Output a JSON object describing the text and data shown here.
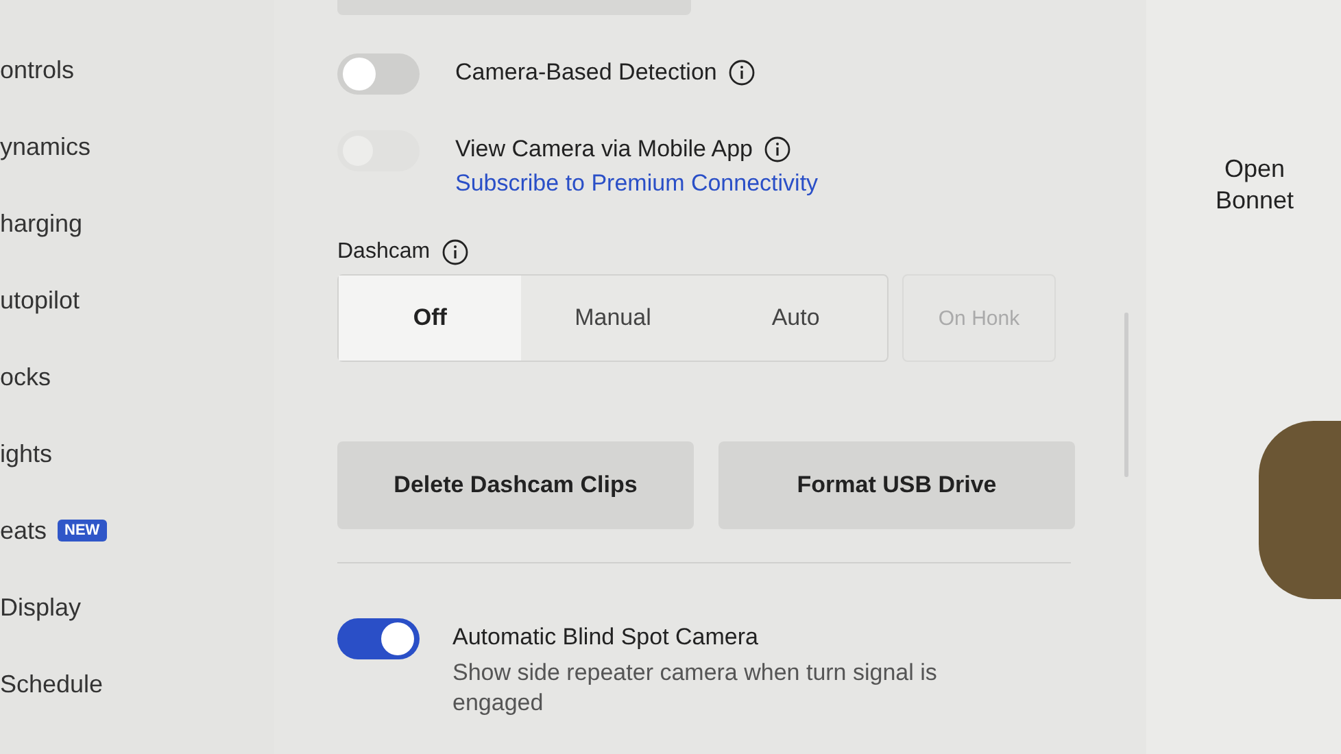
{
  "sidebar": {
    "items": [
      {
        "label": "ontrols"
      },
      {
        "label": "ynamics"
      },
      {
        "label": "harging"
      },
      {
        "label": "utopilot"
      },
      {
        "label": "ocks"
      },
      {
        "label": "ights"
      },
      {
        "label": "eats",
        "badge": "NEW"
      },
      {
        "label": "Display"
      },
      {
        "label": "Schedule"
      }
    ]
  },
  "settings": [
    {
      "kind": "toggle",
      "label": "Camera-Based Detection",
      "on": false,
      "disabled": false
    },
    {
      "kind": "toggle",
      "label": "View Camera via Mobile App",
      "on": false,
      "disabled": true,
      "link": "Subscribe to Premium Connectivity"
    }
  ],
  "dashcam": {
    "label": "Dashcam",
    "options": [
      {
        "label": "Off",
        "selected": true
      },
      {
        "label": "Manual",
        "selected": false
      },
      {
        "label": "Auto",
        "selected": false
      }
    ],
    "extra": {
      "label": "On Honk",
      "disabled": true
    }
  },
  "buttons": [
    "Delete Dashcam Clips",
    "Format USB Drive"
  ],
  "blind_spot": {
    "label": "Automatic Blind Spot Camera",
    "description": "Show side repeater camera when turn signal is engaged",
    "on": true
  },
  "right_panel": {
    "action": "Open Bonnet"
  }
}
